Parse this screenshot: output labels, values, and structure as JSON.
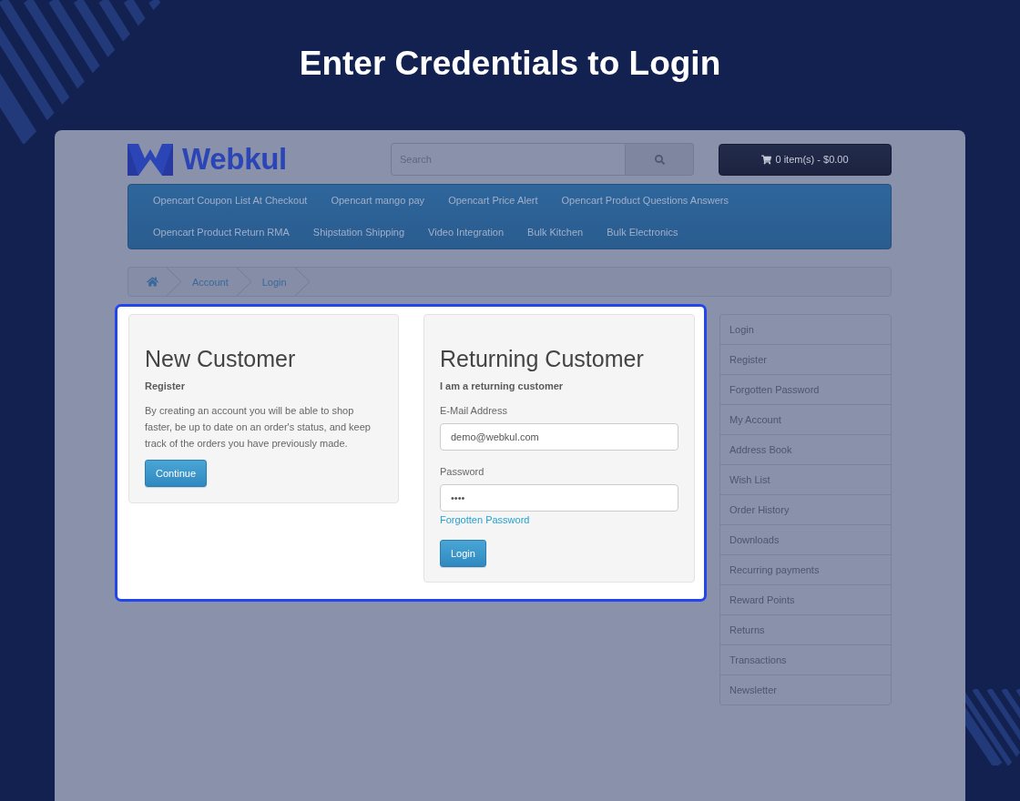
{
  "heading": "Enter Credentials to Login",
  "header": {
    "logo": "Webkul",
    "search": {
      "placeholder": "Search"
    },
    "cart": "0 item(s) - $0.00"
  },
  "menu": [
    "Opencart Coupon List At Checkout",
    "Opencart mango pay",
    "Opencart Price Alert",
    "Opencart Product Questions Answers",
    "Opencart Product Return RMA",
    "Shipstation Shipping",
    "Video Integration",
    "Bulk Kitchen",
    "Bulk Electronics"
  ],
  "breadcrumb": [
    "Account",
    "Login"
  ],
  "new_customer": {
    "title": "New Customer",
    "subtitle": "Register",
    "text": "By creating an account you will be able to shop faster, be up to date on an order's status, and keep track of the orders you have previously made.",
    "button": "Continue"
  },
  "returning_customer": {
    "title": "Returning Customer",
    "subtitle": "I am a returning customer",
    "fields": [
      {
        "label": "E-Mail Address",
        "value": "demo@webkul.com"
      },
      {
        "label": "Password",
        "value": "••••"
      }
    ],
    "link": "Forgotten Password",
    "button": "Login"
  },
  "account_menu": [
    "Login",
    "Register",
    "Forgotten Password",
    "My Account",
    "Address Book",
    "Wish List",
    "Order History",
    "Downloads",
    "Recurring payments",
    "Reward Points",
    "Returns",
    "Transactions",
    "Newsletter"
  ]
}
